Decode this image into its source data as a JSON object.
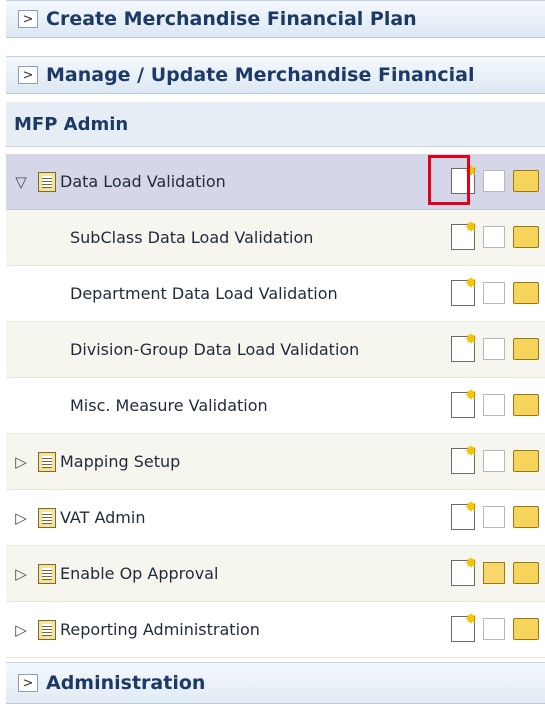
{
  "sections": {
    "create_plan": {
      "expander": ">",
      "label": "Create Merchandise Financial Plan"
    },
    "manage_plan": {
      "expander": ">",
      "label": "Manage / Update Merchandise Financial"
    },
    "mfp_admin": {
      "label": "MFP Admin"
    },
    "administration": {
      "expander": ">",
      "label": "Administration"
    }
  },
  "tree": [
    {
      "label": "Data Load Validation",
      "expander": "▽",
      "level": 0,
      "selected": true,
      "open_enabled": false
    },
    {
      "label": "SubClass Data Load Validation",
      "level": 1,
      "open_enabled": false
    },
    {
      "label": "Department Data Load Validation",
      "level": 1,
      "open_enabled": false
    },
    {
      "label": "Division-Group Data Load Validation",
      "level": 1,
      "open_enabled": false
    },
    {
      "label": "Misc. Measure Validation",
      "level": 1,
      "open_enabled": false
    },
    {
      "label": "Mapping Setup",
      "expander": "▷",
      "level": 0,
      "open_enabled": false
    },
    {
      "label": "VAT Admin",
      "expander": "▷",
      "level": 0,
      "open_enabled": false
    },
    {
      "label": "Enable Op Approval",
      "expander": "▷",
      "level": 0,
      "open_enabled": true
    },
    {
      "label": "Reporting Administration",
      "expander": "▷",
      "level": 0,
      "open_enabled": false
    }
  ],
  "icons": {
    "new": "new-workbook-icon",
    "open": "open-workbook-icon",
    "folder": "open-folder-icon"
  },
  "colors": {
    "highlight": "#e3001b",
    "selected_row": "#d5d7e8"
  }
}
